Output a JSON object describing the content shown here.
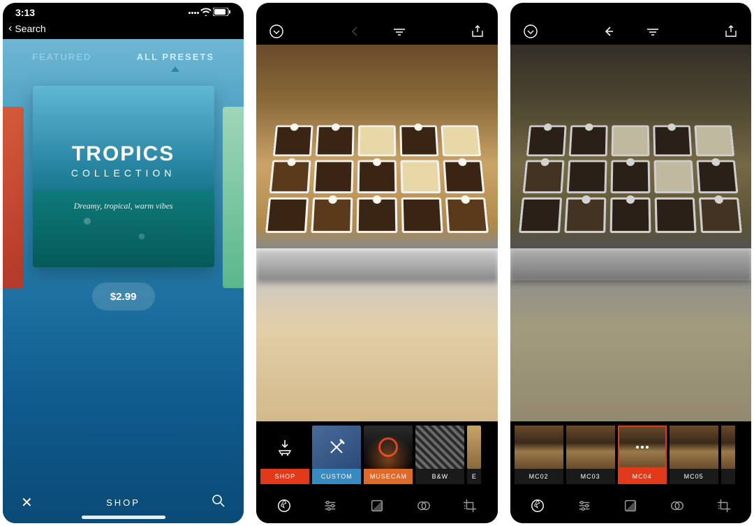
{
  "status": {
    "time": "3:13",
    "back_label": "Search"
  },
  "screen1": {
    "tabs": {
      "featured": "FEATURED",
      "all_presets": "ALL PRESETS"
    },
    "card": {
      "title": "TROPICS",
      "subtitle": "COLLECTION",
      "tagline": "Dreamy, tropical, warm vibes"
    },
    "price": "$2.99",
    "footer": {
      "shop": "SHOP"
    },
    "icons": {
      "close": "close-icon",
      "search": "search-icon"
    }
  },
  "editor_top": {
    "icons": {
      "history": "chevron-circle-down-icon",
      "back": "arrow-left-icon",
      "menu": "lines-icon",
      "share": "share-icon"
    }
  },
  "screen2": {
    "chips": [
      {
        "key": "shop",
        "label": "SHOP",
        "icon": "download-cart-icon"
      },
      {
        "key": "custom",
        "label": "CUSTOM",
        "icon": "brush-cross-icon"
      },
      {
        "key": "musecam",
        "label": "MUSECAM",
        "icon": "ring-icon"
      },
      {
        "key": "bw",
        "label": "B&W"
      },
      {
        "key": "partial",
        "label": "E"
      }
    ]
  },
  "screen3": {
    "filters": [
      {
        "key": "mc02",
        "label": "MC02",
        "selected": false
      },
      {
        "key": "mc03",
        "label": "MC03",
        "selected": false
      },
      {
        "key": "mc04",
        "label": "MC04",
        "selected": true
      },
      {
        "key": "mc05",
        "label": "MC05",
        "selected": false
      },
      {
        "key": "partial",
        "label": "",
        "selected": false
      }
    ]
  },
  "toolbar": {
    "tools": [
      {
        "key": "presets",
        "icon": "aperture-icon"
      },
      {
        "key": "adjust",
        "icon": "sliders-icon"
      },
      {
        "key": "tone",
        "icon": "contrast-split-icon"
      },
      {
        "key": "color",
        "icon": "overlap-circles-icon"
      },
      {
        "key": "crop",
        "icon": "crop-icon"
      }
    ]
  },
  "colors": {
    "accent_red": "#e03a1a",
    "accent_orange": "#e06a2a",
    "accent_blue": "#3a8ac2"
  }
}
